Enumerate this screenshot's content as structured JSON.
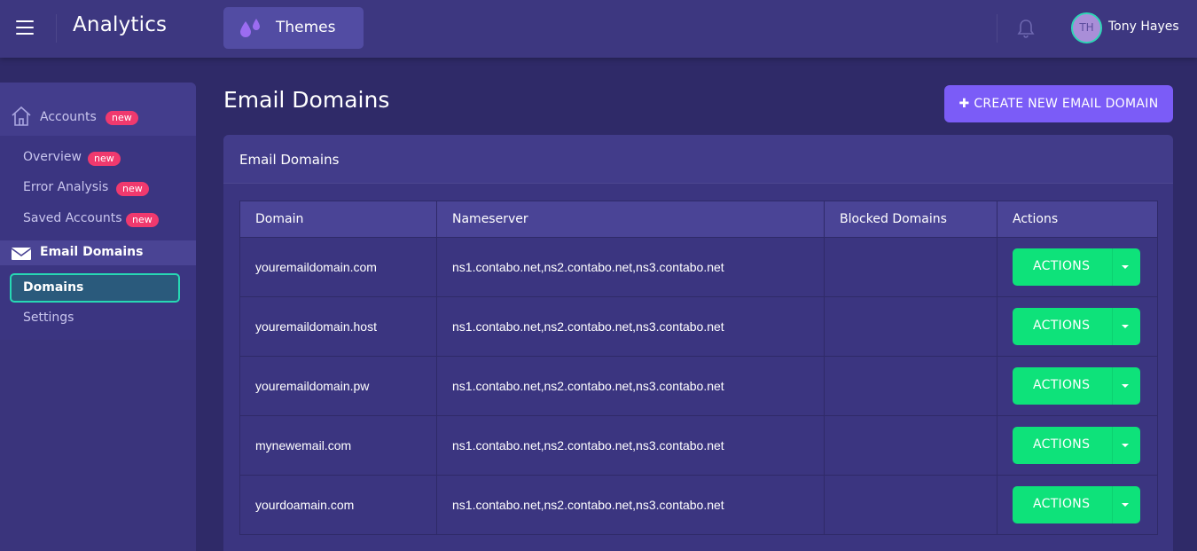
{
  "header": {
    "app_title": "Analytics",
    "themes_label": "Themes",
    "user": {
      "initials": "TH",
      "name": "Tony Hayes"
    }
  },
  "sidebar": {
    "sections": [
      {
        "label": "Accounts",
        "badge": "new",
        "icon": "home-icon",
        "items": [
          {
            "label": "Overview",
            "badge": "new"
          },
          {
            "label": "Error Analysis",
            "badge": "new"
          },
          {
            "label": "Saved Accounts",
            "badge": "new"
          }
        ]
      },
      {
        "label": "Email Domains",
        "icon": "envelope-icon",
        "items": [
          {
            "label": "Domains",
            "active": true
          },
          {
            "label": "Settings"
          }
        ]
      }
    ]
  },
  "main": {
    "page_title": "Email Domains",
    "create_button_label": "CREATE NEW EMAIL DOMAIN",
    "card_title": "Email Domains",
    "table": {
      "columns": [
        "Domain",
        "Nameserver",
        "Blocked Domains",
        "Actions"
      ],
      "action_label": "ACTIONS",
      "rows": [
        {
          "domain": "youremaildomain.com",
          "nameserver": "ns1.contabo.net,ns2.contabo.net,ns3.contabo.net",
          "blocked": ""
        },
        {
          "domain": "youremaildomain.host",
          "nameserver": "ns1.contabo.net,ns2.contabo.net,ns3.contabo.net",
          "blocked": ""
        },
        {
          "domain": "youremaildomain.pw",
          "nameserver": "ns1.contabo.net,ns2.contabo.net,ns3.contabo.net",
          "blocked": ""
        },
        {
          "domain": "mynewemail.com",
          "nameserver": "ns1.contabo.net,ns2.contabo.net,ns3.contabo.net",
          "blocked": ""
        },
        {
          "domain": "yourdoamain.com",
          "nameserver": "ns1.contabo.net,ns2.contabo.net,ns3.contabo.net",
          "blocked": ""
        }
      ]
    }
  },
  "colors": {
    "accent": "#7b5cf7",
    "action_green": "#0ee27a",
    "badge_red": "#f0396e",
    "active_border": "#27d8b4"
  }
}
